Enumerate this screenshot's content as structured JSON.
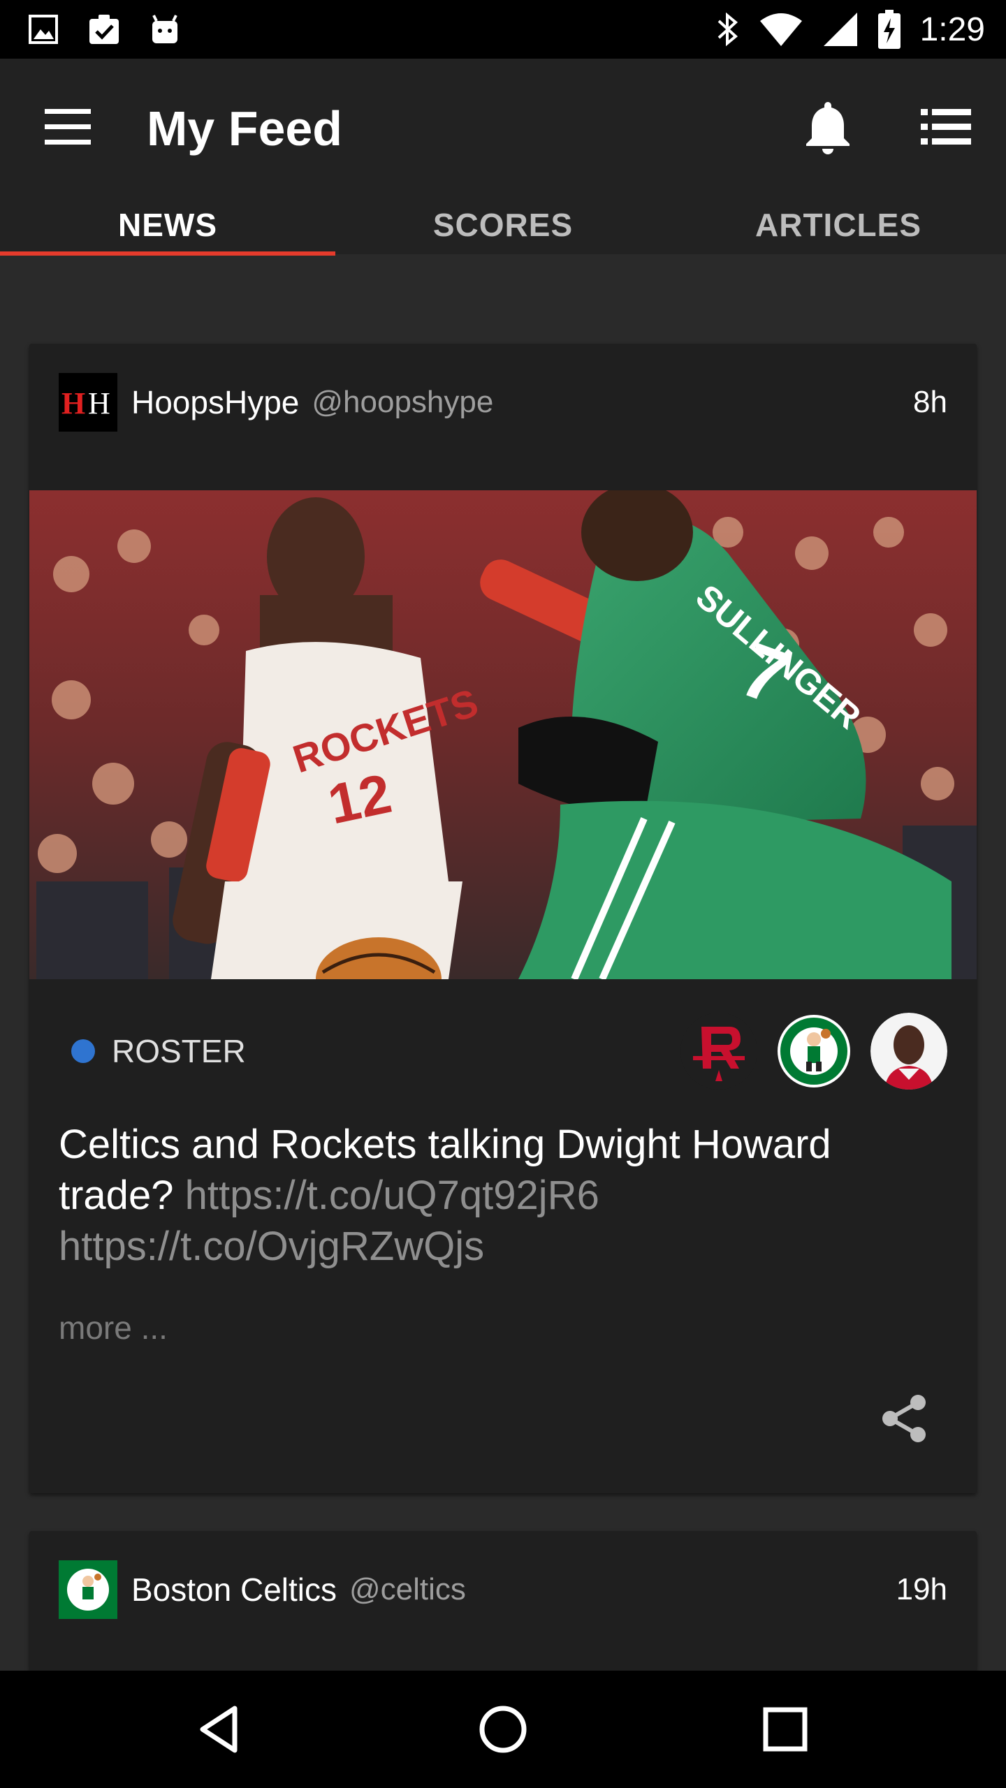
{
  "status_bar": {
    "time": "1:29"
  },
  "app_bar": {
    "title": "My Feed"
  },
  "tabs": [
    {
      "label": "NEWS",
      "active": true
    },
    {
      "label": "SCORES",
      "active": false
    },
    {
      "label": "ARTICLES",
      "active": false
    }
  ],
  "feed": [
    {
      "source_name": "HoopsHype",
      "source_handle": "@hoopshype",
      "time": "8h",
      "tag": "ROSTER",
      "headline": "Celtics and Rockets talking Dwight Howard trade?",
      "links": "https://t.co/uQ7qt92jR6 https://t.co/OvjgRZwQjs",
      "more": "more ...",
      "tag_icons": [
        "rockets-logo-icon",
        "celtics-logo-icon",
        "player-avatar"
      ]
    },
    {
      "source_name": "Boston Celtics",
      "source_handle": "@celtics",
      "time": "19h"
    }
  ],
  "colors": {
    "accent": "#e53b2c",
    "tag_dot": "#2f74d0",
    "background": "#2a2a2a",
    "card": "#1f1f1f"
  }
}
